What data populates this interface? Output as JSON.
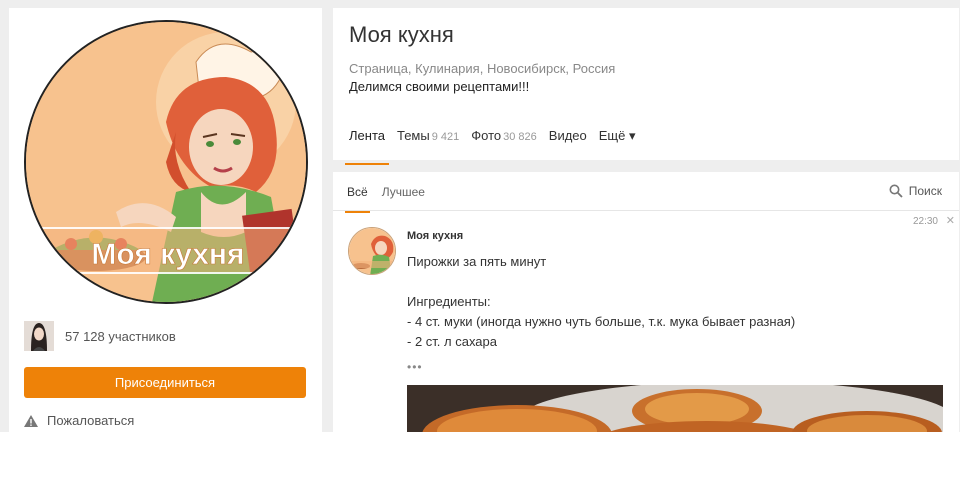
{
  "group": {
    "title": "Моя кухня",
    "title_suffix": "",
    "meta": "Страница, Кулинария, Новосибирск, Россия",
    "description": "Делимся своими рецептами!!!"
  },
  "avatar": {
    "text": "Моя кухня"
  },
  "members": {
    "text": "57 128 участников"
  },
  "join_button": "Присоединиться",
  "report_link": "Пожаловаться",
  "tabs": [
    {
      "label": "Лента",
      "count": "",
      "active": true
    },
    {
      "label": "Темы",
      "count": "9 421"
    },
    {
      "label": "Фото",
      "count": "30 826"
    },
    {
      "label": "Видео",
      "count": ""
    },
    {
      "label": "Ещё ▾",
      "count": ""
    }
  ],
  "feed": {
    "subtabs": [
      {
        "label": "Всё"
      },
      {
        "label": "Лучшее"
      }
    ],
    "search_label": "Поиск"
  },
  "post": {
    "time": "22:30",
    "close": "✕",
    "author": "Моя кухня",
    "title": "Пирожки за пять минут",
    "ingredients_header": "Ингредиенты:",
    "line1": "- 4 ст. муки (иногда нужно чуть больше, т.к. мука бывает разная)",
    "line2": "- 2 ст. л сахара",
    "more": "•••"
  },
  "colors": {
    "accent": "#ee8208",
    "page_bg": "#eeeeee",
    "avatar_bg": "#f7c28e"
  }
}
